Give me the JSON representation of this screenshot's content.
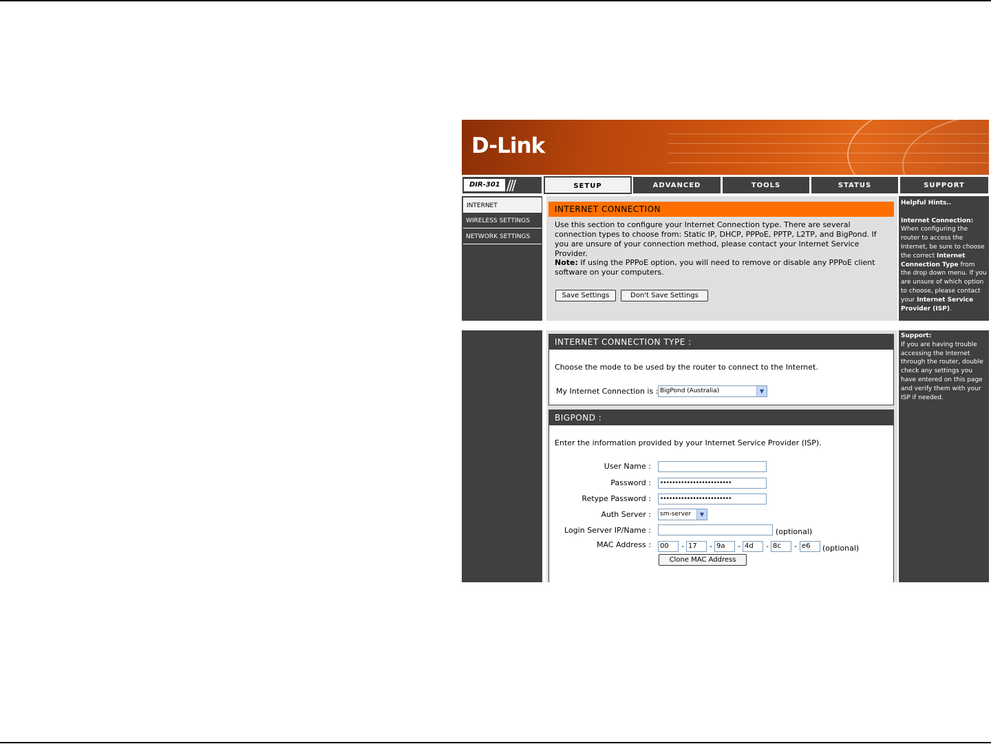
{
  "brand": {
    "logo": "D-Link",
    "model": "DIR-301"
  },
  "tabs": [
    "SETUP",
    "ADVANCED",
    "TOOLS",
    "STATUS",
    "SUPPORT"
  ],
  "sidebar": {
    "items": [
      "INTERNET",
      "WIRELESS SETTINGS",
      "NETWORK SETTINGS"
    ]
  },
  "internet_connection": {
    "title": "INTERNET CONNECTION",
    "intro": "Use this section to configure your Internet Connection type. There are several connection types to choose from: Static IP, DHCP, PPPoE, PPTP, L2TP, and BigPond. If you are unsure of your connection method, please contact your Internet Service Provider.",
    "note_label": "Note:",
    "note_text": "If using the PPPoE option, you will need to remove or disable any PPPoE client software on your computers.",
    "save_label": "Save Settings",
    "dont_save_label": "Don't Save Settings"
  },
  "connection_type": {
    "title": "INTERNET CONNECTION TYPE :",
    "description": "Choose the mode to be used by the router to connect to the Internet.",
    "label": "My Internet Connection is :",
    "value": "BigPond (Australia)"
  },
  "bigpond": {
    "title": "BIGPOND :",
    "description": "Enter the information provided by your Internet Service Provider (ISP).",
    "user_name_label": "User Name :",
    "user_name_value": "",
    "password_label": "Password :",
    "password_value": "••••••••••••••••••••••••",
    "retype_password_label": "Retype Password :",
    "retype_password_value": "••••••••••••••••••••••••",
    "auth_server_label": "Auth Server :",
    "auth_server_value": "sm-server",
    "login_server_label": "Login Server IP/Name :",
    "login_server_value": "",
    "optional_text": "(optional)",
    "mac_label": "MAC Address :",
    "mac": [
      "00",
      "17",
      "9a",
      "4d",
      "8c",
      "e6"
    ],
    "mac_sep": "-",
    "clone_mac_label": "Clone MAC Address"
  },
  "hints": {
    "title": "Helpful Hints..",
    "ic_title": "Internet Connection:",
    "ic_text1": "When configuring the router to access the Internet, be sure to choose the correct",
    "ic_bold1": "Internet Connection Type",
    "ic_text2": "from the drop down menu. If you are unsure of which option to choose, please contact your",
    "ic_bold2": "Internet Service Provider (ISP)",
    "ic_end": ".",
    "support_title": "Support:",
    "support_text": "If you are having trouble accessing the Internet through the router, double check any settings you have entered on this page and verify them with your ISP if needed."
  }
}
